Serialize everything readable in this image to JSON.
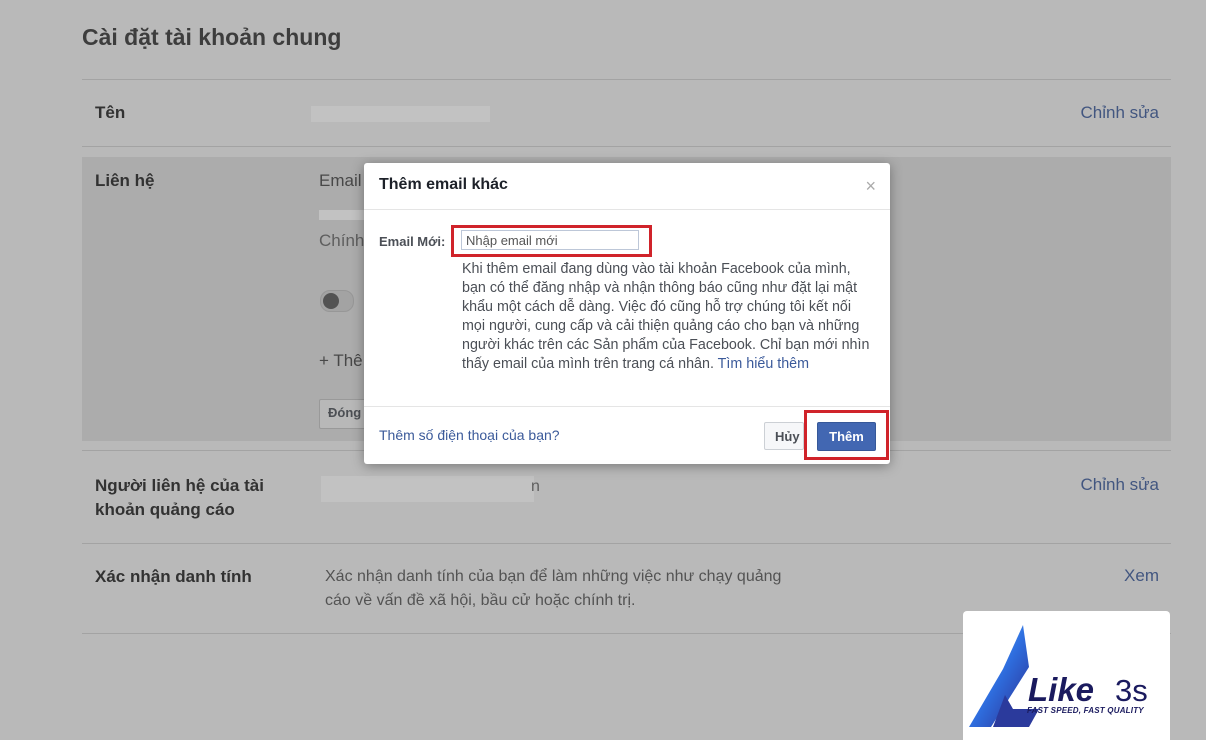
{
  "page": {
    "title": "Cài đặt tài khoản chung",
    "rows": {
      "name": {
        "label": "Tên",
        "action": "Chỉnh sửa"
      },
      "contact": {
        "label": "Liên hệ",
        "email_partial": "Email",
        "edit_partial": "Chính",
        "add_partial": "+ Thê",
        "close_partial": "Đóng"
      },
      "ad_contact": {
        "label_line1": "Người liên hệ của tài",
        "label_line2": "khoản quảng cáo",
        "action": "Chỉnh sửa",
        "trailing": "n"
      },
      "identity": {
        "label": "Xác nhận danh tính",
        "text_line1": "Xác nhận danh tính của bạn để làm những việc như chạy quảng",
        "text_line2": "cáo về vấn đề xã hội, bầu cử hoặc chính trị.",
        "action": "Xem"
      }
    }
  },
  "modal": {
    "title": "Thêm email khác",
    "close_symbol": "×",
    "email_label": "Email Mới:",
    "email_placeholder": "Nhập email mới",
    "description": "Khi thêm email đang dùng vào tài khoản Facebook của mình, bạn có thể đăng nhập và nhận thông báo cũng như đặt lại mật khẩu một cách dễ dàng. Việc đó cũng hỗ trợ chúng tôi kết nối mọi người, cung cấp và cải thiện quảng cáo cho bạn và những người khác trên các Sản phẩm của Facebook. Chỉ bạn mới nhìn thấy email của mình trên trang cá nhân.",
    "learn_more": "Tìm hiểu thêm",
    "phone_link": "Thêm số điện thoại của bạn?",
    "cancel_label": "Hủy",
    "add_label": "Thêm"
  },
  "logo": {
    "brand": "Like",
    "number": "3s",
    "tagline": "FAST SPEED, FAST QUALITY"
  },
  "colors": {
    "link": "#3b5a9a",
    "primary_button": "#4267b2",
    "highlight": "#d0232a"
  }
}
